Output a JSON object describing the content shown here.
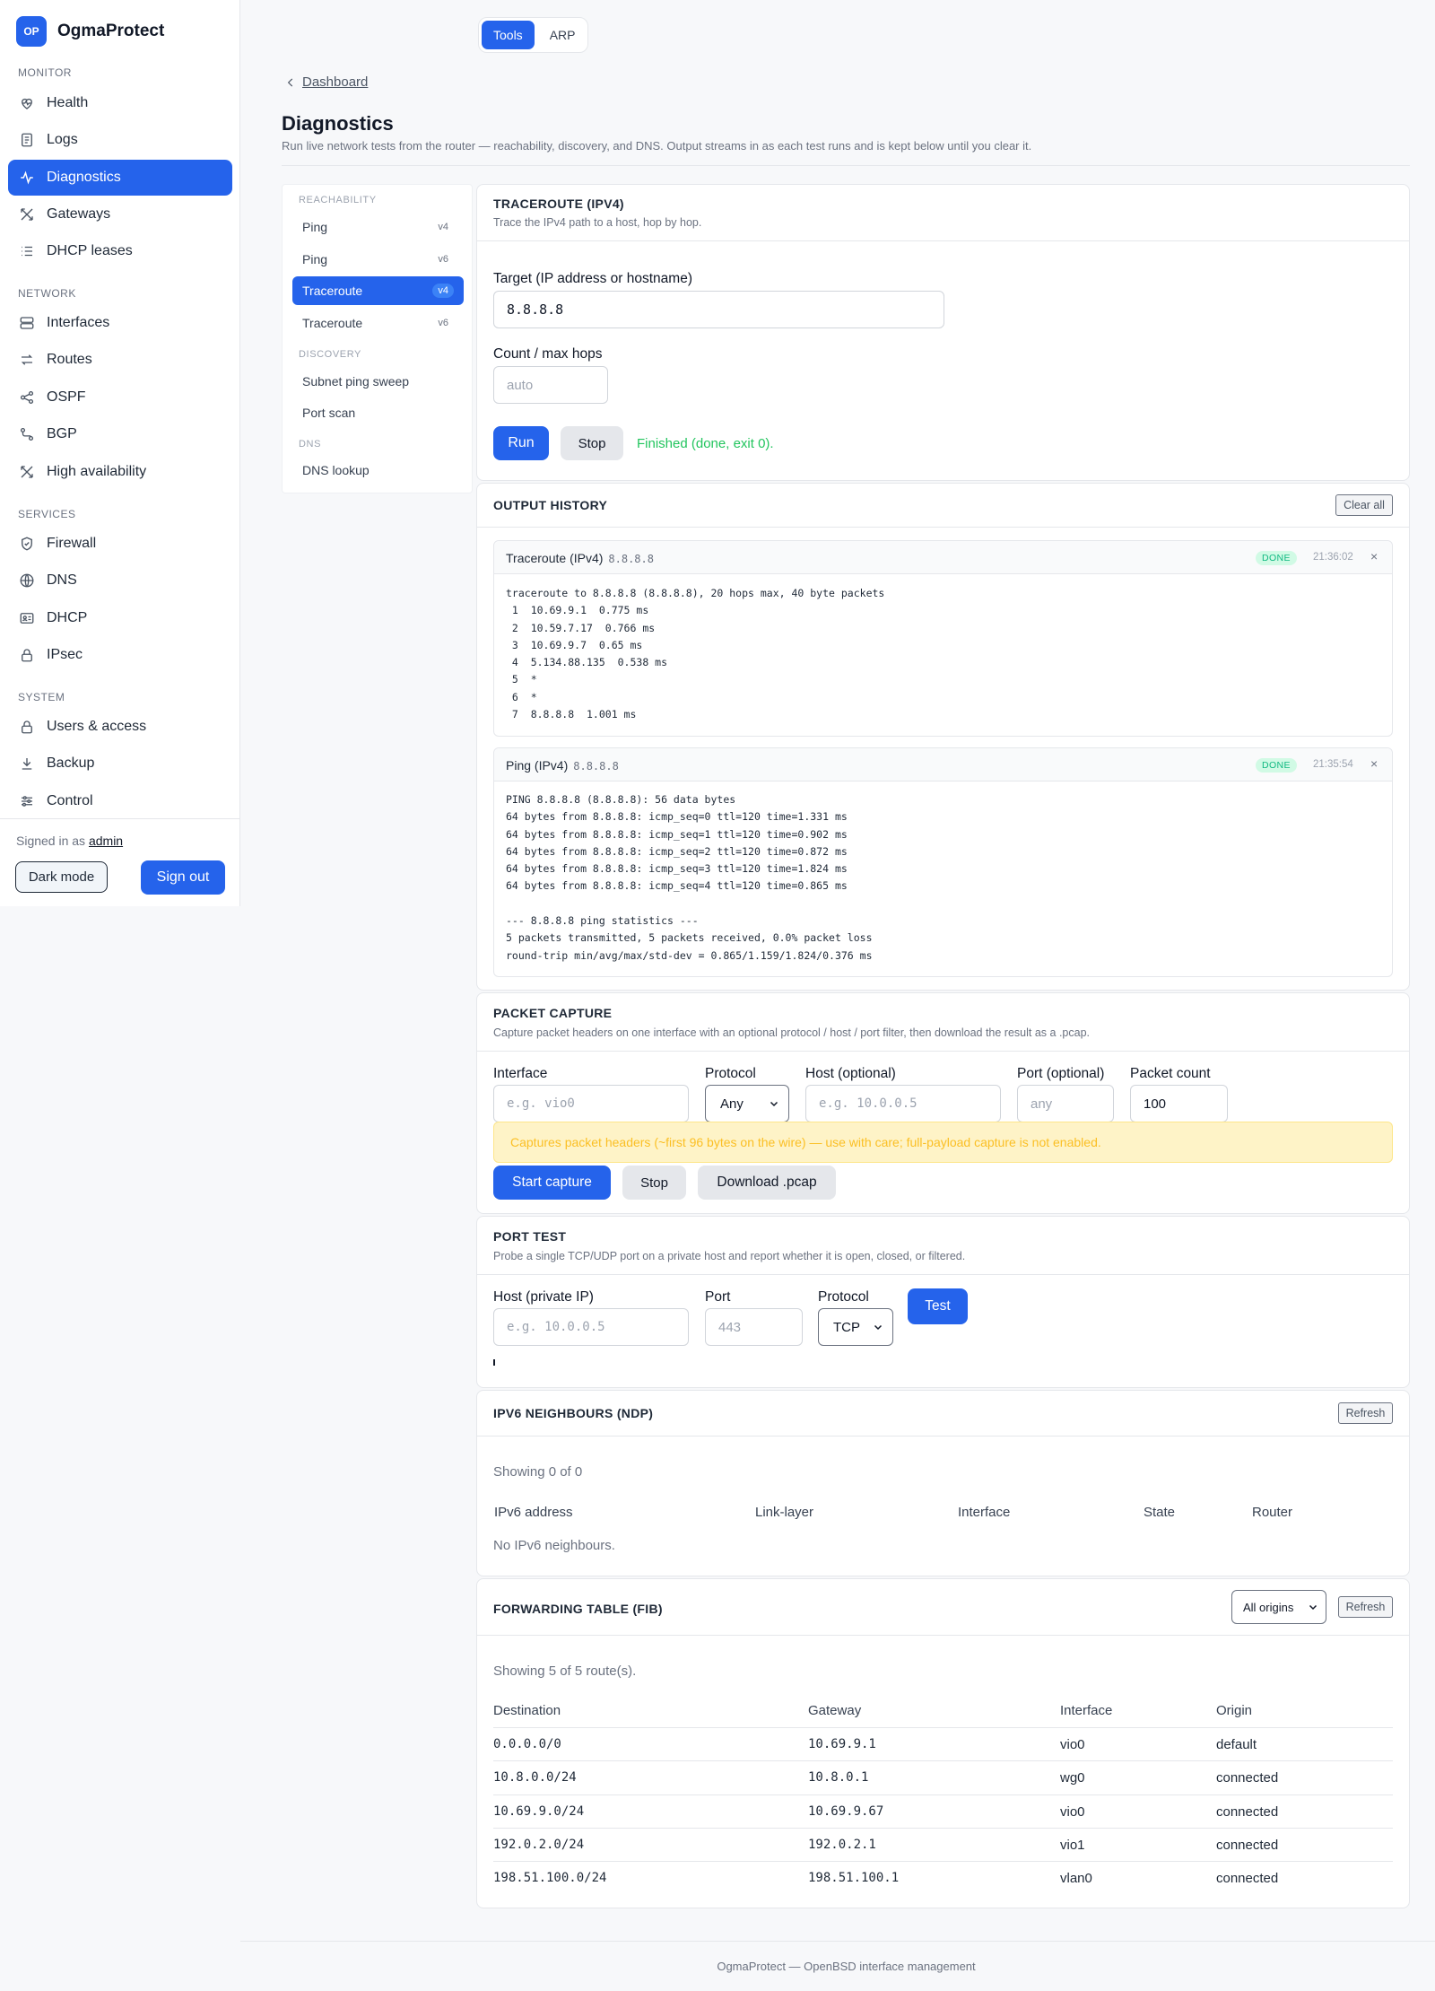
{
  "app": {
    "logo": "OP",
    "name": "OgmaProtect"
  },
  "sidebar": {
    "sections": [
      "MONITOR",
      "NETWORK",
      "SERVICES",
      "SYSTEM"
    ],
    "items": [
      {
        "label": "Health",
        "icon": "heart-pulse-icon"
      },
      {
        "label": "Logs",
        "icon": "document-icon"
      },
      {
        "label": "Diagnostics",
        "icon": "activity-icon",
        "active": true
      },
      {
        "label": "Gateways",
        "icon": "cross-arrows-icon"
      },
      {
        "label": "DHCP leases",
        "icon": "list-icon"
      },
      {
        "label": "Interfaces",
        "icon": "server-icon"
      },
      {
        "label": "Routes",
        "icon": "route-arrows-icon"
      },
      {
        "label": "OSPF",
        "icon": "share-nodes-icon"
      },
      {
        "label": "BGP",
        "icon": "path-icon"
      },
      {
        "label": "High availability",
        "icon": "cross-arrows-icon"
      },
      {
        "label": "Firewall",
        "icon": "shield-icon"
      },
      {
        "label": "DNS",
        "icon": "globe-icon"
      },
      {
        "label": "DHCP",
        "icon": "id-card-icon"
      },
      {
        "label": "IPsec",
        "icon": "lock-icon"
      },
      {
        "label": "Users & access",
        "icon": "lock-icon"
      },
      {
        "label": "Backup",
        "icon": "download-icon"
      },
      {
        "label": "Control",
        "icon": "sliders-icon"
      }
    ],
    "signed_prefix": "Signed in as",
    "user": "admin",
    "dark_mode": "Dark mode",
    "sign_out": "Sign out"
  },
  "top_tabs": {
    "tools": "Tools",
    "arp": "ARP"
  },
  "breadcrumb": "Dashboard",
  "page": {
    "title": "Diagnostics",
    "subtitle": "Run live network tests from the router — reachability, discovery, and DNS. Output streams in as each test runs and is kept below until you clear it."
  },
  "toolnav": {
    "groups": [
      "REACHABILITY",
      "DISCOVERY",
      "DNS"
    ],
    "items": [
      {
        "label": "Ping",
        "badge": "v4"
      },
      {
        "label": "Ping",
        "badge": "v6"
      },
      {
        "label": "Traceroute",
        "badge": "v4",
        "active": true
      },
      {
        "label": "Traceroute",
        "badge": "v6"
      },
      {
        "label": "Subnet ping sweep",
        "badge": ""
      },
      {
        "label": "Port scan",
        "badge": ""
      },
      {
        "label": "DNS lookup",
        "badge": ""
      }
    ]
  },
  "traceroute": {
    "title": "TRACEROUTE (IPV4)",
    "desc": "Trace the IPv4 path to a host, hop by hop.",
    "target_label": "Target (IP address or hostname)",
    "target_value": "8.8.8.8",
    "count_label": "Count / max hops",
    "count_placeholder": "auto",
    "run": "Run",
    "stop": "Stop",
    "status": "Finished (done, exit 0).",
    "status_color": "#22c55e"
  },
  "history": {
    "title": "OUTPUT HISTORY",
    "clear": "Clear all",
    "entries": [
      {
        "name": "Traceroute (IPv4)",
        "target": "8.8.8.8",
        "status": "DONE",
        "time": "21:36:02",
        "close": "×",
        "lines": [
          "traceroute to 8.8.8.8 (8.8.8.8), 20 hops max, 40 byte packets",
          " 1  10.69.9.1  0.775 ms",
          " 2  10.59.7.17  0.766 ms",
          " 3  10.69.9.7  0.65 ms",
          " 4  5.134.88.135  0.538 ms",
          " 5  *",
          " 6  *",
          " 7  8.8.8.8  1.001 ms"
        ]
      },
      {
        "name": "Ping (IPv4)",
        "target": "8.8.8.8",
        "status": "DONE",
        "time": "21:35:54",
        "close": "×",
        "lines": [
          "PING 8.8.8.8 (8.8.8.8): 56 data bytes",
          "64 bytes from 8.8.8.8: icmp_seq=0 ttl=120 time=1.331 ms",
          "64 bytes from 8.8.8.8: icmp_seq=1 ttl=120 time=0.902 ms",
          "64 bytes from 8.8.8.8: icmp_seq=2 ttl=120 time=0.872 ms",
          "64 bytes from 8.8.8.8: icmp_seq=3 ttl=120 time=1.824 ms",
          "64 bytes from 8.8.8.8: icmp_seq=4 ttl=120 time=0.865 ms",
          "",
          "--- 8.8.8.8 ping statistics ---",
          "5 packets transmitted, 5 packets received, 0.0% packet loss",
          "round-trip min/avg/max/std-dev = 0.865/1.159/1.824/0.376 ms"
        ]
      }
    ]
  },
  "capture": {
    "title": "PACKET CAPTURE",
    "desc": "Capture packet headers on one interface with an optional protocol / host / port filter, then download the result as a .pcap.",
    "interface_label": "Interface",
    "interface_placeholder": "e.g. vio0",
    "protocol_label": "Protocol",
    "protocol_value": "Any",
    "host_label": "Host (optional)",
    "host_placeholder": "e.g. 10.0.0.5",
    "port_label": "Port (optional)",
    "port_placeholder": "any",
    "count_label": "Packet count",
    "count_value": "100",
    "warning": "Captures packet headers (~first 96 bytes on the wire) — use with care; full-payload capture is not enabled.",
    "start": "Start capture",
    "stop": "Stop",
    "download": "Download .pcap"
  },
  "porttest": {
    "title": "PORT TEST",
    "desc": "Probe a single TCP/UDP port on a private host and report whether it is open, closed, or filtered.",
    "host_label": "Host (private IP)",
    "host_placeholder": "e.g. 10.0.0.5",
    "port_label": "Port",
    "port_placeholder": "443",
    "protocol_label": "Protocol",
    "protocol_value": "TCP",
    "test": "Test"
  },
  "ndp": {
    "title": "IPV6 NEIGHBOURS (NDP)",
    "refresh": "Refresh",
    "showing": "Showing 0 of 0",
    "columns": [
      "IPv6 address",
      "Link-layer",
      "Interface",
      "State",
      "Router"
    ],
    "empty": "No IPv6 neighbours."
  },
  "fib": {
    "title": "FORWARDING TABLE (FIB)",
    "origin_filter": "All origins",
    "refresh": "Refresh",
    "showing": "Showing 5 of 5 route(s).",
    "columns": [
      "Destination",
      "Gateway",
      "Interface",
      "Origin"
    ],
    "rows": [
      [
        "0.0.0.0/0",
        "10.69.9.1",
        "vio0",
        "default"
      ],
      [
        "10.8.0.0/24",
        "10.8.0.1",
        "wg0",
        "connected"
      ],
      [
        "10.69.9.0/24",
        "10.69.9.67",
        "vio0",
        "connected"
      ],
      [
        "192.0.2.0/24",
        "192.0.2.1",
        "vio1",
        "connected"
      ],
      [
        "198.51.100.0/24",
        "198.51.100.1",
        "vlan0",
        "connected"
      ]
    ]
  },
  "footer": "OgmaProtect — OpenBSD interface management"
}
